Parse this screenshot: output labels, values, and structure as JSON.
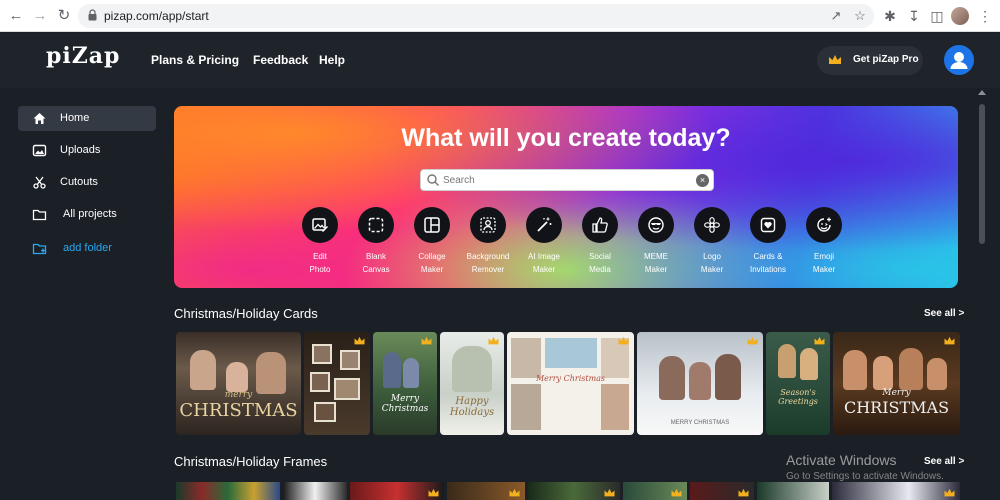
{
  "browser": {
    "url": "pizap.com/app/start"
  },
  "header": {
    "logo": "piZap",
    "nav": [
      "Plans & Pricing",
      "Feedback",
      "Help"
    ],
    "pro_button": "Get piZap Pro"
  },
  "sidebar": {
    "items": [
      {
        "label": "Home",
        "icon": "home-icon"
      },
      {
        "label": "Uploads",
        "icon": "image-icon"
      },
      {
        "label": "Cutouts",
        "icon": "scissors-icon"
      },
      {
        "label": "All projects",
        "icon": "folder-icon"
      },
      {
        "label": "add folder",
        "icon": "add-folder-icon"
      }
    ]
  },
  "hero": {
    "title": "What will you create today?",
    "search_placeholder": "Search",
    "tools": [
      {
        "label": "Edit\nPhoto",
        "icon": "edit-photo-icon"
      },
      {
        "label": "Blank\nCanvas",
        "icon": "blank-canvas-icon"
      },
      {
        "label": "Collage\nMaker",
        "icon": "collage-icon"
      },
      {
        "label": "Background\nRemover",
        "icon": "background-remover-icon"
      },
      {
        "label": "AI Image\nMaker",
        "icon": "magic-wand-icon"
      },
      {
        "label": "Social\nMedia",
        "icon": "thumbs-up-icon"
      },
      {
        "label": "MEME\nMaker",
        "icon": "meme-face-icon"
      },
      {
        "label": "Logo\nMaker",
        "icon": "flower-logo-icon"
      },
      {
        "label": "Cards &\nInvitations",
        "icon": "card-heart-icon"
      },
      {
        "label": "Emoji\nMaker",
        "icon": "emoji-icon"
      }
    ]
  },
  "sections": [
    {
      "title": "Christmas/Holiday Cards",
      "see_all": "See all >"
    },
    {
      "title": "Christmas/Holiday Frames",
      "see_all": "See all >"
    }
  ],
  "cards": [
    {
      "text": "CHRISTMAS",
      "small": "merry",
      "pro": false
    },
    {
      "text": "",
      "small": "",
      "pro": true
    },
    {
      "text": "Merry Christmas",
      "small": "",
      "pro": true
    },
    {
      "text": "Happy Holidays",
      "small": "",
      "pro": true
    },
    {
      "text": "Merry Christmas",
      "small": "",
      "pro": true
    },
    {
      "text": "MERRY CHRISTMAS",
      "small": "",
      "pro": true
    },
    {
      "text": "Season's Greetings",
      "small": "",
      "pro": true
    },
    {
      "text": "CHRISTMAS",
      "small": "Merry",
      "pro": true
    }
  ],
  "watermark": {
    "title": "Activate Windows",
    "subtitle": "Go to Settings to activate Windows."
  },
  "colors": {
    "bg": "#1b1f26",
    "accent": "#1d74e6",
    "add_folder": "#2aa8f0",
    "crown": "#f2b01e"
  }
}
